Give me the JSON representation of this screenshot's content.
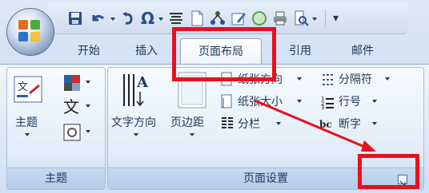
{
  "tabs": [
    "开始",
    "插入",
    "页面布局",
    "引用",
    "邮件"
  ],
  "groups": {
    "theme": {
      "label": "主题",
      "theme_button": "主题"
    },
    "page_setup": {
      "label": "页面设置",
      "text_direction": "文字方向",
      "margins": "页边距",
      "orientation": "纸张方向",
      "size": "纸张大小",
      "columns": "分栏",
      "breaks": "分隔符",
      "line_numbers": "行号",
      "hyphenation": "断字"
    }
  },
  "icons": {
    "office_button": "office-orb-icon",
    "save": "save-icon",
    "undo": "undo-icon",
    "redo": "redo-icon",
    "symbol": "omega-icon",
    "align": "align-icon",
    "new": "new-doc-icon",
    "share": "share-icon",
    "edit": "edit-icon",
    "circle": "circle-icon",
    "print": "print-icon",
    "preview": "print-preview-icon",
    "customize": "customize-qat-icon",
    "dialog_launcher": "dialog-launcher-icon"
  },
  "annotation": {
    "color": "#e8101c"
  }
}
